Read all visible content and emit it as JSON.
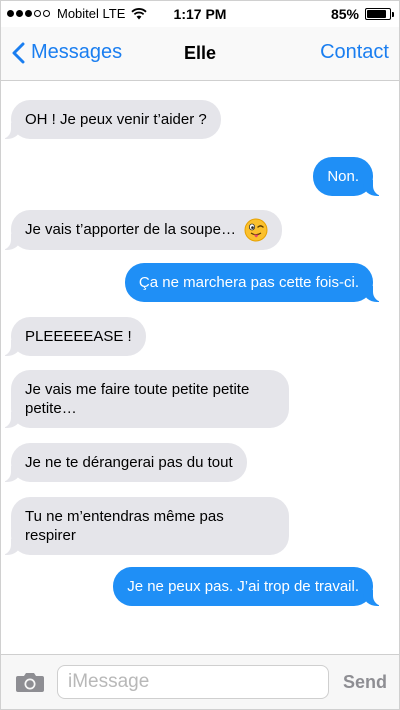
{
  "status_bar": {
    "carrier": "Mobitel LTE",
    "time": "1:17 PM",
    "battery": "85%",
    "battery_level": 0.85
  },
  "nav": {
    "back_label": "Messages",
    "title": "Elle",
    "contact_label": "Contact"
  },
  "messages": [
    {
      "sender": "them",
      "text": "OH ! Je peux venir t’aider ?"
    },
    {
      "sender": "me",
      "text": "Non."
    },
    {
      "sender": "them",
      "text": "Je vais t’apporter de la soupe…",
      "emoji": "winking-tongue-emoji"
    },
    {
      "sender": "me",
      "text": "Ça ne marchera pas cette fois-ci."
    },
    {
      "sender": "them",
      "text": "PLEEEEEASE !"
    },
    {
      "sender": "them",
      "text": "Je vais me faire toute petite petite petite…"
    },
    {
      "sender": "them",
      "text": "Je ne te dérangerai pas du tout"
    },
    {
      "sender": "them",
      "text": "Tu ne m’entendras même pas respirer"
    },
    {
      "sender": "me",
      "text": "Je ne peux pas. J’ai trop de travail."
    }
  ],
  "input": {
    "placeholder": "iMessage",
    "send_label": "Send"
  },
  "colors": {
    "accent": "#1a7ef0",
    "outgoing_bubble": "#1f8ff6",
    "incoming_bubble": "#e5e5ea"
  },
  "icons": {
    "back": "chevron-left-icon",
    "camera": "camera-icon",
    "wifi": "wifi-icon",
    "battery": "battery-icon"
  }
}
